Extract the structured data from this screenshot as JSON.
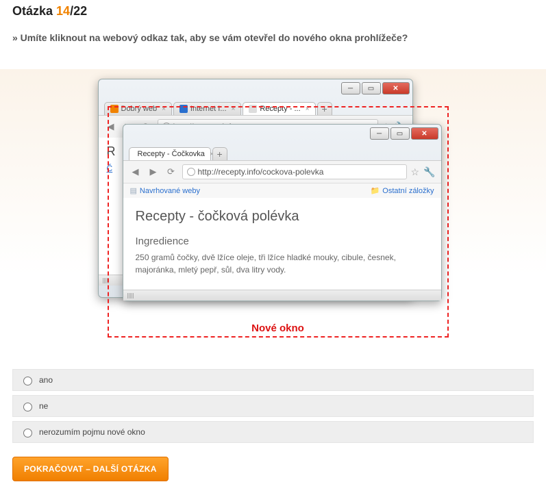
{
  "header": {
    "label": "Otázka",
    "current": "14",
    "sep": "/",
    "total": "22"
  },
  "question": "» Umíte kliknout na webový odkaz tak, aby se vám otevřel do nového okna prohlížeče?",
  "backWindow": {
    "tabs": [
      {
        "label": "Dobrý web",
        "favicon": "fi-orange"
      },
      {
        "label": "Internet I...",
        "favicon": "fi-blue"
      },
      {
        "label": "Recepty - ...",
        "favicon": "fi-none",
        "active": true
      }
    ],
    "url": "http://recepty.info",
    "stubTitle": "R",
    "stubLink": "Č"
  },
  "frontWindow": {
    "tab": "Recepty - Čočkovka",
    "url": "http://recepty.info/cockova-polevka",
    "bookmarksLeft": "Navrhované weby",
    "bookmarksRight": "Ostatní záložky",
    "title": "Recepty - čočková polévka",
    "subtitle": "Ingredience",
    "body": "250 gramů čočky, dvě lžíce oleje, tři lžíce hladké mouky, cibule, česnek, majoránka, mletý pepř, sůl, dva litry vody."
  },
  "dashedLabel": "Nové okno",
  "answers": [
    "ano",
    "ne",
    "nerozumím pojmu nové okno"
  ],
  "continueLabel": "POKRAČOVAT – DALŠÍ OTÁZKA"
}
